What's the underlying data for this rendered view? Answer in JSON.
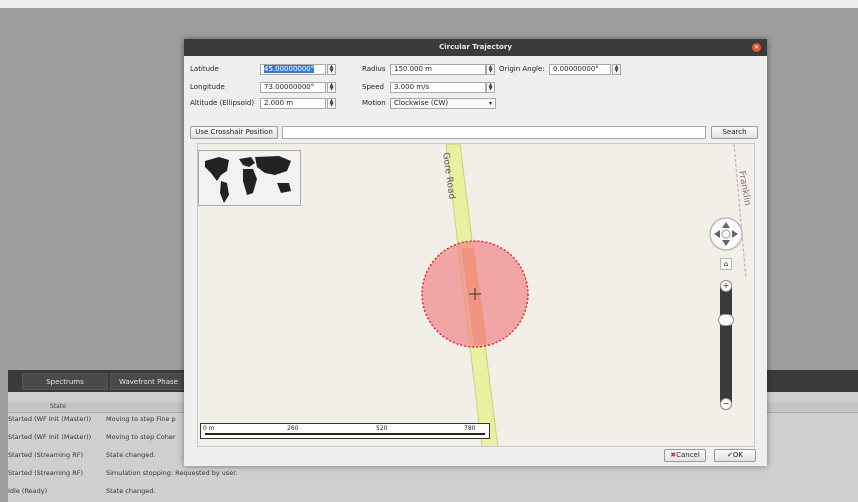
{
  "dialog": {
    "title": "Circular Trajectory",
    "latitude_label": "Latitude",
    "latitude_value": "45.00000000°",
    "longitude_label": "Longitude",
    "longitude_value": "73.00000000°",
    "altitude_label": "Altitude (Ellipsoid)",
    "altitude_value": "2.000 m",
    "radius_label": "Radius",
    "radius_value": "150.000 m",
    "speed_label": "Speed",
    "speed_value": "3.000 m/s",
    "motion_label": "Motion",
    "motion_value": "Clockwise (CW)",
    "origin_angle_label": "Origin Angle:",
    "origin_angle_value": "0.00000000°",
    "crosshair_button": "Use Crosshair Position",
    "search_button": "Search",
    "cancel_button": "Cancel",
    "ok_button": "OK"
  },
  "map": {
    "road_gore": "Gore Road",
    "road_franklin": "Franklin",
    "scale_ticks": [
      "0 m",
      "260",
      "520",
      "780"
    ],
    "zoom_in": "+",
    "zoom_out": "−",
    "home": "⌂"
  },
  "background": {
    "tabs": [
      "Spectrums",
      "Wavefront Phase"
    ],
    "table_header": "State",
    "rows": [
      {
        "state": "Started (WF Init (Master))",
        "message": "Moving to step Fine p"
      },
      {
        "state": "Started (WF Init (Master))",
        "message": "Moving to step Coher"
      },
      {
        "state": "Started (Streaming RF)",
        "message": "State changed."
      },
      {
        "state": "Started (Streaming RF)",
        "message": "Simulation stopping: Requested by user."
      },
      {
        "state": "Idle (Ready)",
        "message": "State changed."
      }
    ]
  },
  "colors": {
    "titlebar": "#3b3b3b",
    "close": "#e05a2b",
    "circle_fill": "#f08c8c",
    "circle_stroke": "#e0202a",
    "road": "#e9f0a0"
  }
}
